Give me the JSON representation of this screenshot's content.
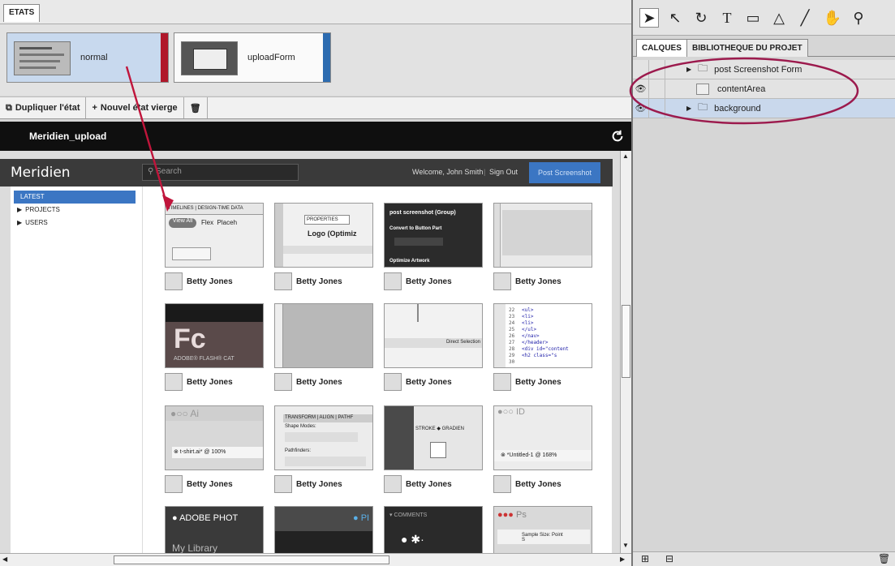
{
  "states": {
    "tab_label": "ETATS",
    "items": [
      {
        "name": "normal",
        "bar_color": "#b0172a"
      },
      {
        "name": "uploadForm",
        "bar_color": "#2c6bb0"
      }
    ],
    "toolbar": {
      "duplicate_label": "Dupliquer l'état",
      "new_label": "Nouvel état vierge",
      "delete_icon": "trash-icon"
    }
  },
  "document": {
    "title": "Meridien_upload"
  },
  "app": {
    "logo": "Meridien",
    "search_placeholder": "Search",
    "welcome": "Welcome, John Smith",
    "signout": "Sign Out",
    "post_button": "Post Screenshot",
    "nav": [
      {
        "label": "LATEST",
        "active": true
      },
      {
        "label": "PROJECTS",
        "active": false
      },
      {
        "label": "USERS",
        "active": false
      }
    ],
    "grid": [
      {
        "author": "Betty Jones",
        "thumb": "Timelines panel"
      },
      {
        "author": "Betty Jones",
        "thumb": "Properties panel"
      },
      {
        "author": "Betty Jones",
        "thumb": "post screenshot (Group)"
      },
      {
        "author": "Betty Jones",
        "thumb": "Grey panel"
      },
      {
        "author": "Betty Jones",
        "thumb": "FC Adobe Flash Catalyst"
      },
      {
        "author": "Betty Jones",
        "thumb": "Grey ruler"
      },
      {
        "author": "Betty Jones",
        "thumb": "Direct Selection"
      },
      {
        "author": "Betty Jones",
        "thumb": "Code view"
      },
      {
        "author": "Betty Jones",
        "thumb": "Illustrator t-shirt.ai"
      },
      {
        "author": "Betty Jones",
        "thumb": "Transform Align Pathfinder"
      },
      {
        "author": "Betty Jones",
        "thumb": "Stroke Gradient"
      },
      {
        "author": "Betty Jones",
        "thumb": "InDesign Untitled-1 @ 168%"
      },
      {
        "author": "",
        "thumb": "ADOBE PHOT My Library"
      },
      {
        "author": "",
        "thumb": "Photoshop bar"
      },
      {
        "author": "",
        "thumb": "COMMENTS"
      },
      {
        "author": "",
        "thumb": "Ps Sample Size: Point S"
      }
    ]
  },
  "right_panel": {
    "tabs": [
      "CALQUES",
      "BIBLIOTHEQUE DU PROJET"
    ],
    "layers": [
      {
        "name": "post Screenshot Form",
        "visible": false,
        "type": "folder"
      },
      {
        "name": "contentArea",
        "visible": true,
        "type": "item"
      },
      {
        "name": "background",
        "visible": true,
        "type": "folder"
      }
    ]
  },
  "colors": {
    "accent": "#3b76c3",
    "annotation": "#9c1a4d",
    "arrow": "#c0153b"
  }
}
